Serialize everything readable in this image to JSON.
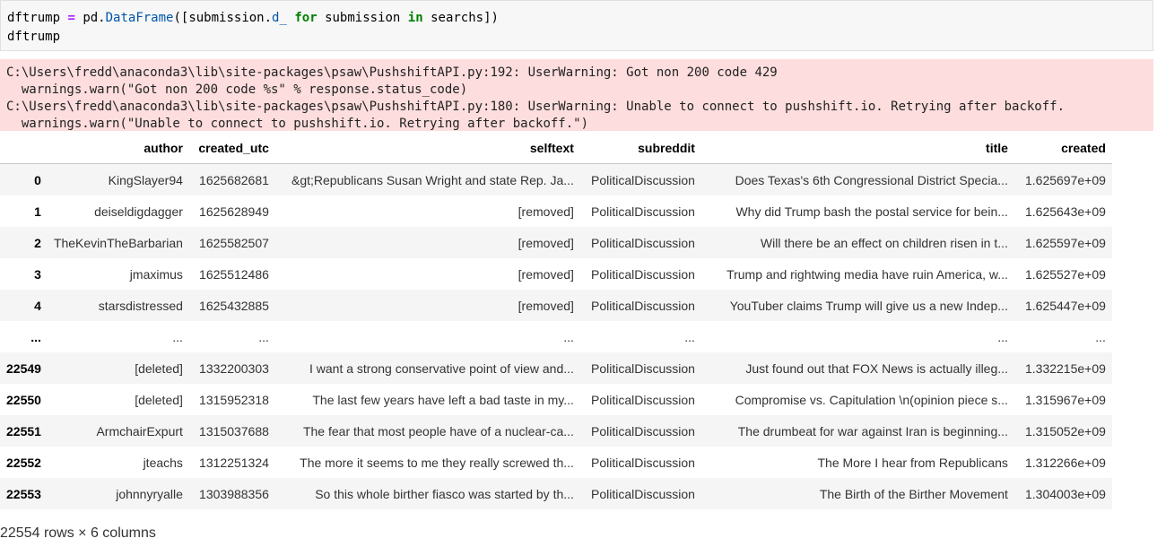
{
  "code": {
    "line1": {
      "v1": "dftrump",
      "eq": " = ",
      "a": "pd.",
      "fn": "DataFrame",
      "b": "([submission.",
      "attr": "d_",
      "sp1": " ",
      "kw1": "for",
      "c": " submission ",
      "kw2": "in",
      "d": " searchs])"
    },
    "line2": "dftrump"
  },
  "stderr": {
    "lines": [
      "C:\\Users\\fredd\\anaconda3\\lib\\site-packages\\psaw\\PushshiftAPI.py:192: UserWarning: Got non 200 code 429",
      "  warnings.warn(\"Got non 200 code %s\" % response.status_code)",
      "C:\\Users\\fredd\\anaconda3\\lib\\site-packages\\psaw\\PushshiftAPI.py:180: UserWarning: Unable to connect to pushshift.io. Retrying after backoff.",
      "  warnings.warn(\"Unable to connect to pushshift.io. Retrying after backoff.\")"
    ]
  },
  "table": {
    "columns": [
      "",
      "author",
      "created_utc",
      "selftext",
      "subreddit",
      "title",
      "created"
    ],
    "rows": [
      [
        "0",
        "KingSlayer94",
        "1625682681",
        "&gt;Republicans Susan Wright and state Rep. Ja...",
        "PoliticalDiscussion",
        "Does Texas's 6th Congressional District Specia...",
        "1.625697e+09"
      ],
      [
        "1",
        "deiseldigdagger",
        "1625628949",
        "[removed]",
        "PoliticalDiscussion",
        "Why did Trump bash the postal service for bein...",
        "1.625643e+09"
      ],
      [
        "2",
        "TheKevinTheBarbarian",
        "1625582507",
        "[removed]",
        "PoliticalDiscussion",
        "Will there be an effect on children risen in t...",
        "1.625597e+09"
      ],
      [
        "3",
        "jmaximus",
        "1625512486",
        "[removed]",
        "PoliticalDiscussion",
        "Trump and rightwing media have ruin America, w...",
        "1.625527e+09"
      ],
      [
        "4",
        "starsdistressed",
        "1625432885",
        "[removed]",
        "PoliticalDiscussion",
        "YouTuber claims Trump will give us a new Indep...",
        "1.625447e+09"
      ],
      [
        "...",
        "...",
        "...",
        "...",
        "...",
        "...",
        "..."
      ],
      [
        "22549",
        "[deleted]",
        "1332200303",
        "I want a strong conservative point of view and...",
        "PoliticalDiscussion",
        "Just found out that FOX News is actually illeg...",
        "1.332215e+09"
      ],
      [
        "22550",
        "[deleted]",
        "1315952318",
        "The last few years have left a bad taste in my...",
        "PoliticalDiscussion",
        "Compromise vs. Capitulation \\n(opinion piece s...",
        "1.315967e+09"
      ],
      [
        "22551",
        "ArmchairExpurt",
        "1315037688",
        "The fear that most people have of a nuclear-ca...",
        "PoliticalDiscussion",
        "The drumbeat for war against Iran is beginning...",
        "1.315052e+09"
      ],
      [
        "22552",
        "jteachs",
        "1312251324",
        "The more it seems to me they really screwed th...",
        "PoliticalDiscussion",
        "The More I hear from Republicans",
        "1.312266e+09"
      ],
      [
        "22553",
        "johnnyryalle",
        "1303988356",
        "So this whole birther fiasco was started by th...",
        "PoliticalDiscussion",
        "The Birth of the Birther Movement",
        "1.304003e+09"
      ]
    ]
  },
  "footer": "22554 rows × 6 columns"
}
